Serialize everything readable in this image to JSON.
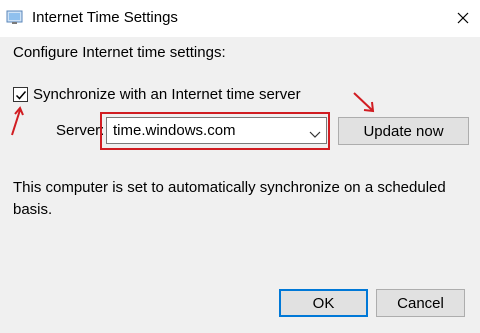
{
  "window": {
    "title": "Internet Time Settings"
  },
  "dialog": {
    "heading": "Configure Internet time settings:",
    "sync_label": "Synchronize with an Internet time server",
    "sync_checked": true,
    "server_label": "Server:",
    "server_value": "time.windows.com",
    "update_button": "Update now",
    "status_text": "This computer is set to automatically synchronize on a scheduled basis.",
    "ok_button": "OK",
    "cancel_button": "Cancel"
  },
  "annotations": {
    "highlight_color": "#d11d22"
  }
}
